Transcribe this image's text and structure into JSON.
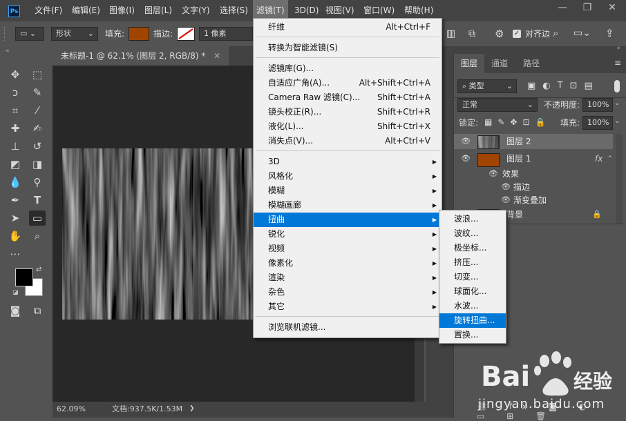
{
  "menubar": {
    "app_icon": "Ps",
    "items": [
      "文件(F)",
      "编辑(E)",
      "图像(I)",
      "图层(L)",
      "文字(Y)",
      "选择(S)",
      "滤镜(T)",
      "3D(D)",
      "视图(V)",
      "窗口(W)",
      "帮助(H)"
    ],
    "window_controls": [
      "minimize-icon",
      "restore-icon",
      "close-icon"
    ]
  },
  "options": {
    "shape_mode": "形状",
    "fill_label": "填充:",
    "fill_color": "#a04500",
    "stroke_label": "描边:",
    "stroke_width": "1 像素",
    "align_edges": "对齐边"
  },
  "document": {
    "tab_title": "未标题-1 @ 62.1% (图层 2, RGB/8) *",
    "zoom": "62.09%",
    "doc_size": "文档:937.5K/1.53M"
  },
  "layers_panel": {
    "tabs": [
      "图层",
      "通道",
      "路径"
    ],
    "kind_filter": "类型",
    "blend_mode": "正常",
    "opacity_label": "不透明度:",
    "opacity": "100%",
    "lock_label": "锁定:",
    "fill_label": "填充:",
    "fill": "100%",
    "layers": [
      {
        "name": "图层 2",
        "selected": true
      },
      {
        "name": "图层 1",
        "fx": "fx",
        "effects_label": "效果",
        "effects": [
          "描边",
          "渐变叠加"
        ]
      },
      {
        "name": "背景",
        "locked": true
      }
    ]
  },
  "filter_menu": {
    "items": [
      {
        "label": "纤维",
        "shortcut": "Alt+Ctrl+F"
      },
      {
        "label": "转换为智能滤镜(S)",
        "shortcut": ""
      },
      {
        "label": "滤镜库(G)...",
        "shortcut": ""
      },
      {
        "label": "自适应广角(A)...",
        "shortcut": "Alt+Shift+Ctrl+A"
      },
      {
        "label": "Camera Raw 滤镜(C)...",
        "shortcut": "Shift+Ctrl+A"
      },
      {
        "label": "镜头校正(R)...",
        "shortcut": "Shift+Ctrl+R"
      },
      {
        "label": "液化(L)...",
        "shortcut": "Shift+Ctrl+X"
      },
      {
        "label": "消失点(V)...",
        "shortcut": "Alt+Ctrl+V"
      },
      {
        "label": "3D",
        "submenu": true
      },
      {
        "label": "风格化",
        "submenu": true
      },
      {
        "label": "模糊",
        "submenu": true
      },
      {
        "label": "模糊画廊",
        "submenu": true
      },
      {
        "label": "扭曲",
        "submenu": true,
        "highlighted": true
      },
      {
        "label": "锐化",
        "submenu": true
      },
      {
        "label": "视频",
        "submenu": true
      },
      {
        "label": "像素化",
        "submenu": true
      },
      {
        "label": "渲染",
        "submenu": true
      },
      {
        "label": "杂色",
        "submenu": true
      },
      {
        "label": "其它",
        "submenu": true
      },
      {
        "label": "浏览联机滤镜...",
        "shortcut": ""
      }
    ]
  },
  "distort_submenu": {
    "items": [
      "波浪...",
      "波纹...",
      "极坐标...",
      "挤压...",
      "切变...",
      "球面化...",
      "水波...",
      "旋转扭曲...",
      "置换..."
    ],
    "highlighted_index": 7
  },
  "watermark": {
    "brand": "Bai",
    "brand2": "经验",
    "url": "jingyan.baidu.com"
  }
}
